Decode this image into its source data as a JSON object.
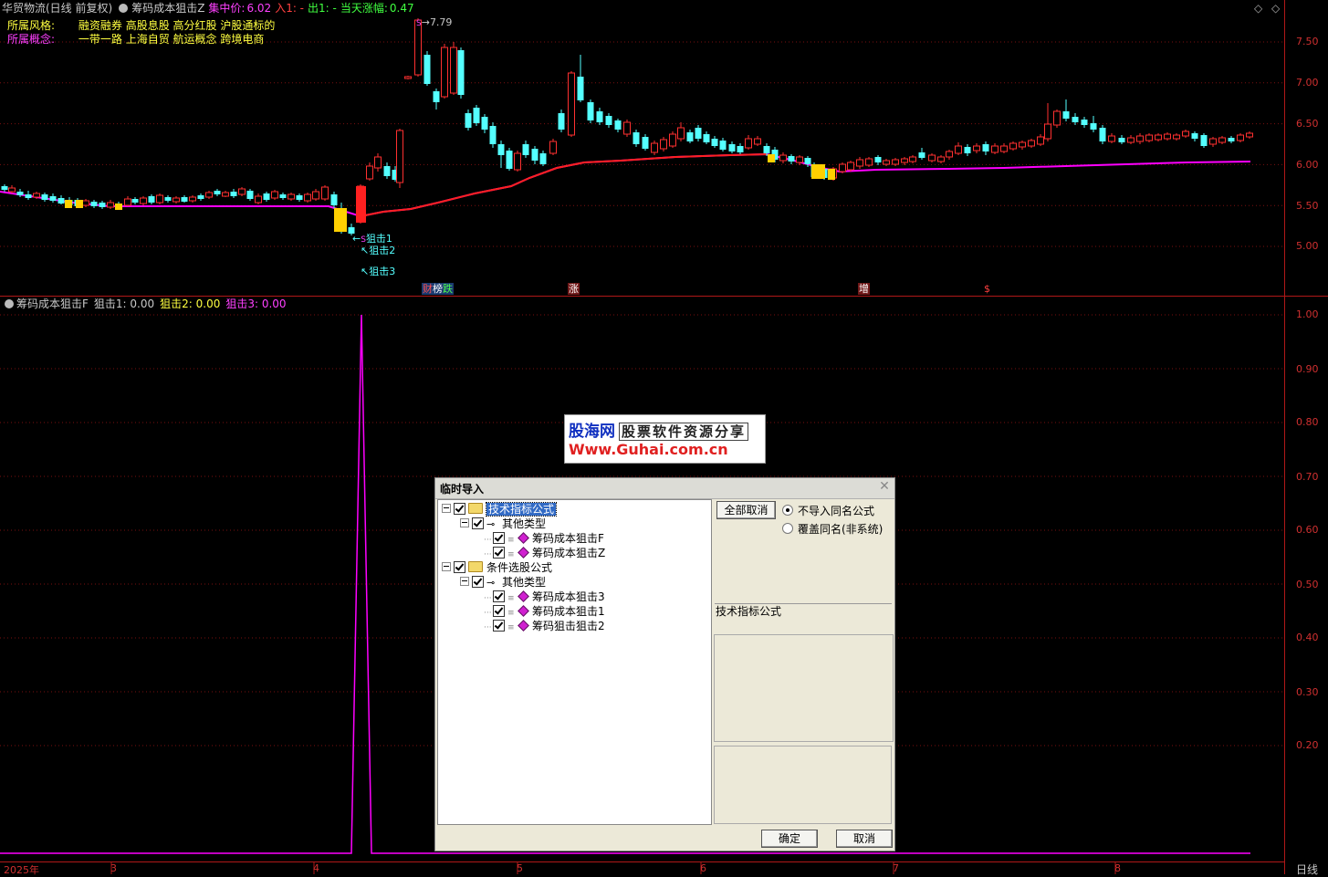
{
  "header": {
    "stock": "华贸物流(日线 前复权)",
    "indicator_main": "筹码成本狙击Z",
    "concentration_label": "集中价:",
    "concentration_value": "6.02",
    "in_label": "入1: -",
    "out_label": "出1: -",
    "change_label": "当天涨幅:",
    "change_value": "0.47"
  },
  "info": {
    "style_label": "所属风格:",
    "style_value": "融资融券 高股息股 高分红股 沪股通标的",
    "concept_label": "所属概念:",
    "concept_value": "一带一路 上海自贸 航运概念 跨境电商"
  },
  "price_axis": [
    "7.50",
    "7.00",
    "6.50",
    "6.00",
    "5.50",
    "5.00"
  ],
  "high_marker": "7.79",
  "signal_labels": [
    "狙击1",
    "狙击2",
    "狙击3"
  ],
  "signal_s_label": "S",
  "event_tags": [
    {
      "text": "财",
      "color": "#ff4040"
    },
    {
      "text": "榜",
      "color": "#ffffff"
    },
    {
      "text": "跌",
      "color": "#40ff40"
    },
    {
      "text": "涨",
      "color": "#ffffff"
    },
    {
      "text": "增",
      "color": "#ffffff"
    },
    {
      "text": "$",
      "color": "#ff4040"
    }
  ],
  "sub_header": {
    "name": "筹码成本狙击F",
    "s1": "狙击1: 0.00",
    "s2": "狙击2: 0.00",
    "s3": "狙击3: 0.00"
  },
  "sub_axis": [
    "1.00",
    "0.90",
    "0.80",
    "0.70",
    "0.60",
    "0.50",
    "0.40",
    "0.30",
    "0.20"
  ],
  "time_axis": [
    "2025年",
    "3",
    "4",
    "5",
    "6",
    "7",
    "8"
  ],
  "period_label": "日线",
  "watermark": {
    "line1_brand": "股海网",
    "line1_slogan": "股票软件资源分享",
    "line2": "Www.Guhai.com.cn"
  },
  "dialog": {
    "title": "临时导入",
    "tree": {
      "root1": "技术指标公式",
      "root1_child": "其他类型",
      "root1_items": [
        "筹码成本狙击F",
        "筹码成本狙击Z"
      ],
      "root2": "条件选股公式",
      "root2_child": "其他类型",
      "root2_items": [
        "筹码成本狙击3",
        "筹码成本狙击1",
        "筹码狙击狙击2"
      ]
    },
    "deselect_all": "全部取消",
    "radio_no_import": "不导入同名公式",
    "radio_overwrite": "覆盖同名(非系统)",
    "info_label": "技术指标公式",
    "ok": "确定",
    "cancel": "取消"
  },
  "colors": {
    "up": "#ff3030",
    "down": "#54ffff",
    "cost_line": "#ff00ff",
    "grid": "#7a1010",
    "signal": "#ff00ff"
  }
}
